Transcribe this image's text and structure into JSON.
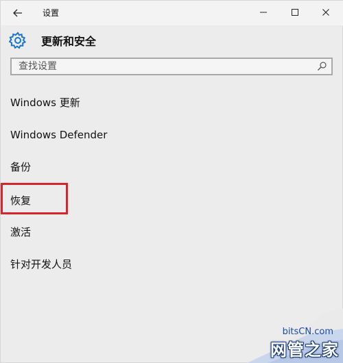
{
  "window": {
    "title": "设置"
  },
  "header": {
    "title": "更新和安全"
  },
  "search": {
    "placeholder": "查找设置",
    "value": ""
  },
  "nav": {
    "items": [
      {
        "label": "Windows 更新"
      },
      {
        "label": "Windows Defender"
      },
      {
        "label": "备份"
      },
      {
        "label": "恢复"
      },
      {
        "label": "激活"
      },
      {
        "label": "针对开发人员"
      }
    ]
  },
  "watermark": {
    "site": "bitsCN.com",
    "brand": "网管之家"
  },
  "colors": {
    "accent": "#1a75d1",
    "highlight": "#d9232d",
    "background": "#ececec"
  },
  "icons": {
    "back": "back-arrow-icon",
    "minimize": "minimize-icon",
    "maximize": "maximize-icon",
    "close": "close-icon",
    "gear": "gear-icon",
    "search": "search-icon"
  }
}
